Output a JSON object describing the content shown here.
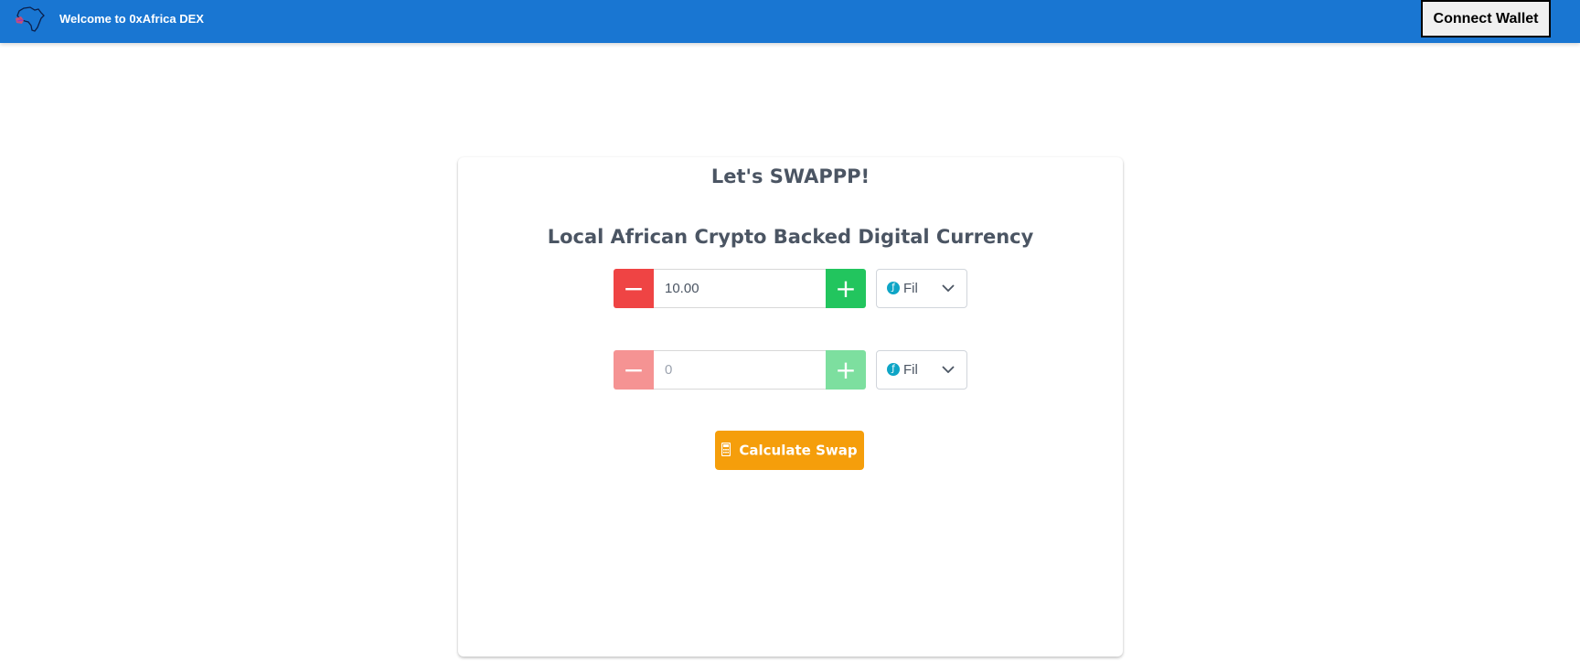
{
  "header": {
    "title": "Welcome to 0xAfrica DEX",
    "logo_icon": "africa-map-icon",
    "connect_label": "Connect Wallet",
    "background_color": "#1976d2"
  },
  "swap": {
    "title": "Let's SWAPPP!",
    "subtitle": "Local African Crypto Backed Digital Currency",
    "from": {
      "value": "10.00",
      "placeholder": "",
      "token": "Fil",
      "minus_label": "−",
      "plus_label": "+"
    },
    "to": {
      "value": "",
      "placeholder": "0",
      "token": "Fil",
      "minus_label": "−",
      "plus_label": "+"
    },
    "calculate_label": "Calculate Swap",
    "calculate_icon": "calculator-icon",
    "token_icon": "filecoin-icon"
  },
  "colors": {
    "minus": "#ef4444",
    "plus": "#22c55e",
    "calculate": "#f59e0b"
  }
}
